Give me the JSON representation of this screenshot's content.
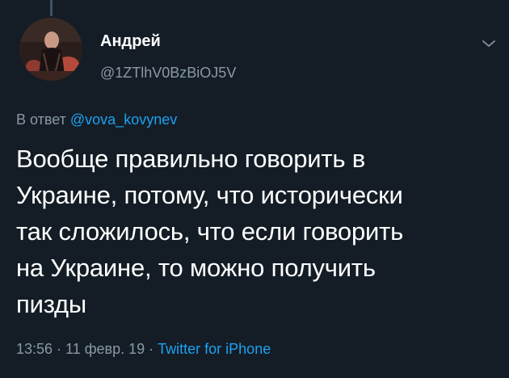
{
  "tweet": {
    "author_name": "Андрей",
    "author_handle": "@1ZTlhV0BzBiOJ5V",
    "reply_prefix": "В ответ ",
    "reply_mention": "@vova_kovynev",
    "text": "Вообще правильно говорить в\nУкраине, потому, что исторически\nтак сложилось, что если говорить\nна Украине, то можно получить\nпизды",
    "time": "13:56",
    "date": "11 февр. 19",
    "separator": " · ",
    "source": "Twitter for iPhone"
  },
  "icons": {
    "menu": "chevron-down-icon",
    "avatar": "avatar"
  },
  "colors": {
    "background": "#141d26",
    "text": "#ffffff",
    "secondary": "#8899a6",
    "link": "#1da1f2"
  }
}
